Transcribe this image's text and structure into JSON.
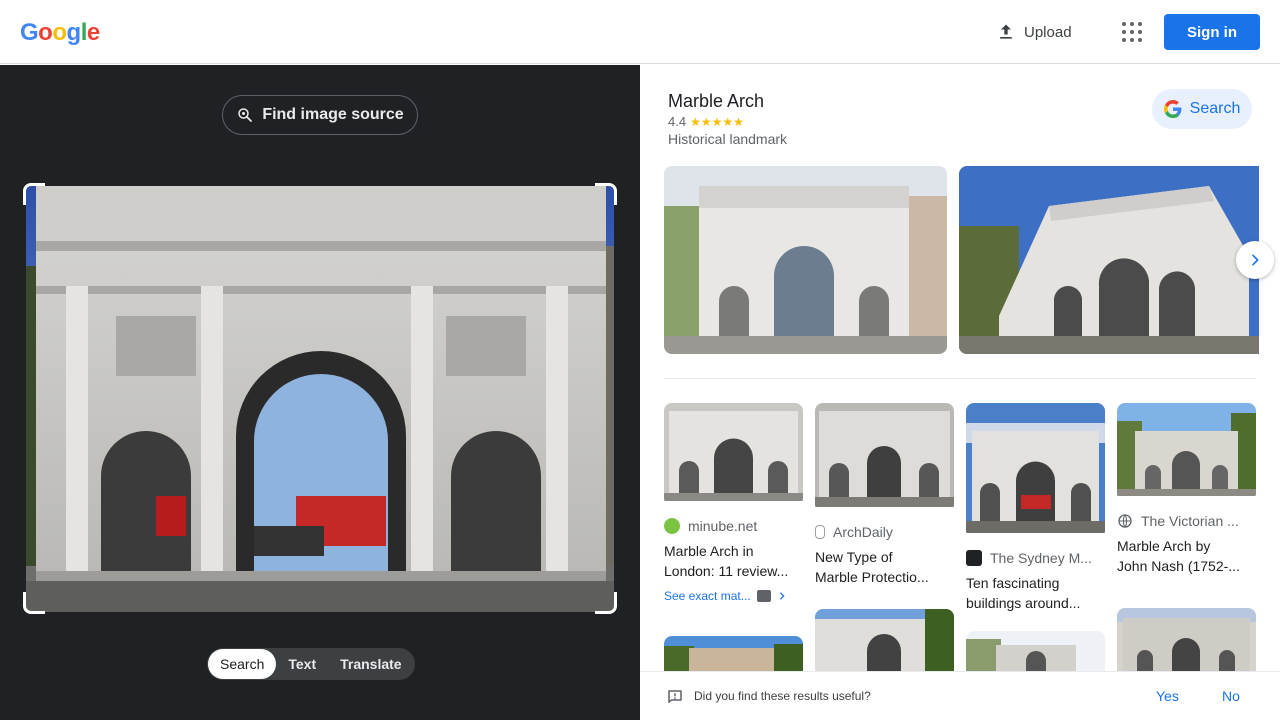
{
  "header": {
    "logo": [
      "G",
      "o",
      "o",
      "g",
      "l",
      "e"
    ],
    "logo_colors": [
      "#4285f4",
      "#ea4335",
      "#fbbc05",
      "#4285f4",
      "#34a853",
      "#ea4335"
    ],
    "upload_label": "Upload",
    "signin_label": "Sign in"
  },
  "left": {
    "find_source_label": "Find image source",
    "modes": [
      {
        "label": "Search",
        "active": true
      },
      {
        "label": "Text",
        "active": false
      },
      {
        "label": "Translate",
        "active": false
      }
    ]
  },
  "knowledge_panel": {
    "title": "Marble Arch",
    "rating": "4.4",
    "stars": "★★★★★",
    "type": "Historical landmark",
    "search_label": "Search"
  },
  "results": [
    {
      "source": "minube.net",
      "title_lines": [
        "Marble Arch in",
        "London: 11 review..."
      ],
      "exact_label": "See exact mat..."
    },
    {
      "source": "ArchDaily",
      "title_lines": [
        "New Type of",
        "Marble Protectio..."
      ]
    },
    {
      "source": "The Sydney M...",
      "title_lines": [
        "Ten fascinating",
        "buildings around..."
      ]
    },
    {
      "source": "The Victorian ...",
      "title_lines": [
        "Marble Arch by",
        "John Nash (1752-..."
      ]
    }
  ],
  "feedback": {
    "question": "Did you find these results useful?",
    "yes": "Yes",
    "no": "No"
  },
  "colors": {
    "accent": "#1a73e8",
    "dark_bg": "#202124"
  }
}
